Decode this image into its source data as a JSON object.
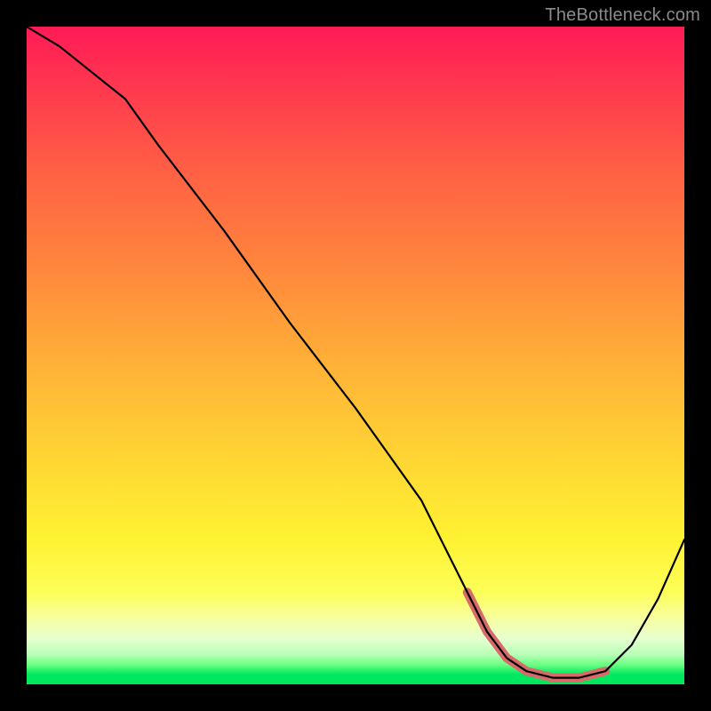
{
  "watermark": "TheBottleneck.com",
  "chart_data": {
    "type": "line",
    "title": "",
    "xlabel": "",
    "ylabel": "",
    "xlim": [
      0,
      100
    ],
    "ylim": [
      0,
      100
    ],
    "grid": false,
    "legend": false,
    "series": [
      {
        "name": "bottleneck-curve",
        "x": [
          0,
          5,
          10,
          15,
          20,
          30,
          40,
          50,
          60,
          67,
          70,
          73,
          76,
          80,
          84,
          88,
          92,
          96,
          100
        ],
        "values": [
          100,
          97,
          93,
          89,
          82,
          69,
          55,
          42,
          28,
          14,
          8,
          4,
          2,
          1,
          1,
          2,
          6,
          13,
          22
        ]
      }
    ],
    "highlight": {
      "name": "optimal-range-marker",
      "color": "#d86a6a",
      "x": [
        67,
        70,
        73,
        76,
        80,
        84,
        88
      ],
      "values": [
        14,
        8,
        4,
        2,
        1,
        1,
        2
      ]
    },
    "background_gradient": {
      "top": "#ff1a56",
      "mid": "#ffd634",
      "bottom": "#00e85f"
    }
  }
}
